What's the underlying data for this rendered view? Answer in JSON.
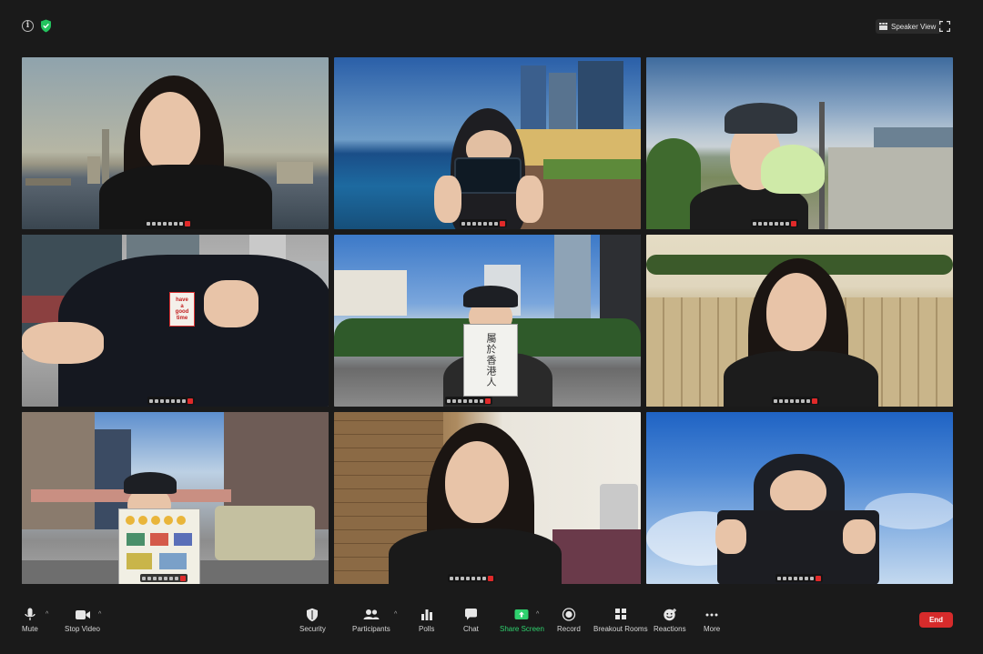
{
  "top_bar": {
    "speaker_view_label": "Speaker View",
    "icons": [
      "info-icon",
      "shield-check-icon",
      "grid-icon",
      "fullscreen-icon"
    ]
  },
  "gallery": {
    "tiles": [
      {
        "note": "",
        "sign_text": ""
      },
      {
        "note": "",
        "sign_text": ""
      },
      {
        "note": "",
        "sign_text": ""
      },
      {
        "note": "",
        "sign_text": "have\na\ngood\ntime"
      },
      {
        "note": "",
        "sign_text": "屬於香港人"
      },
      {
        "note": "",
        "sign_text": ""
      },
      {
        "note": "",
        "sign_text": ""
      },
      {
        "note": "",
        "sign_text": ""
      },
      {
        "note": "",
        "sign_text": ""
      }
    ]
  },
  "toolbar": {
    "mute_label": "Mute",
    "stop_video_label": "Stop Video",
    "security_label": "Security",
    "participants_label": "Participants",
    "polls_label": "Polls",
    "chat_label": "Chat",
    "share_screen_label": "Share Screen",
    "record_label": "Record",
    "breakout_rooms_label": "Breakout Rooms",
    "reactions_label": "Reactions",
    "more_label": "More",
    "end_label": "End",
    "share_color": "#2fd16e",
    "end_color": "#d62b2b"
  }
}
